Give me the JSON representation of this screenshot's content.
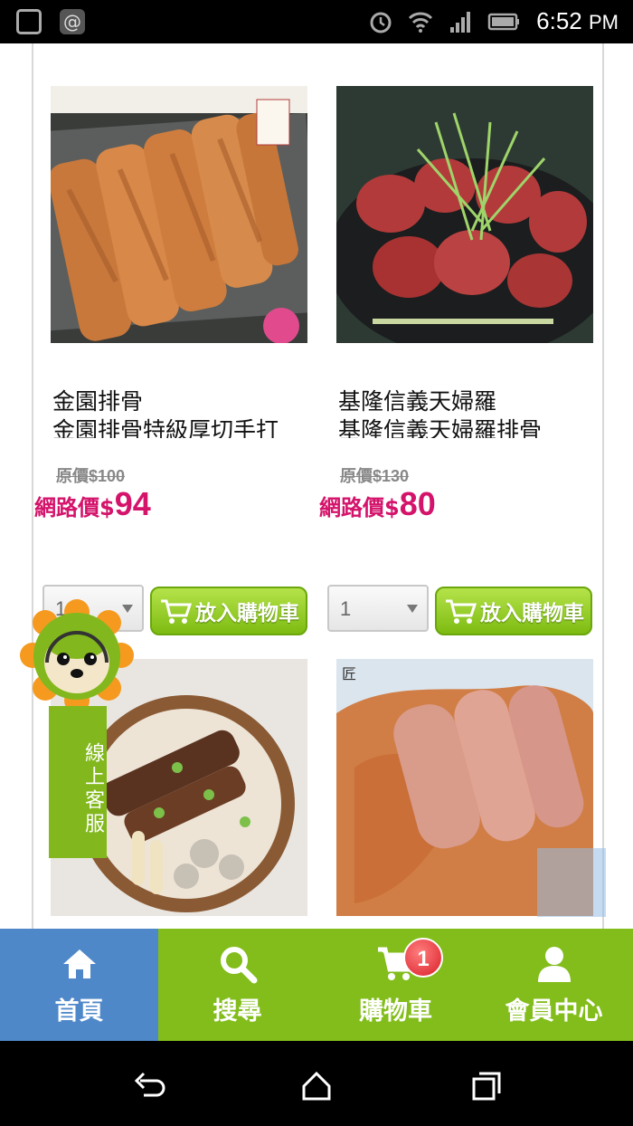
{
  "status_bar": {
    "time": "6:52",
    "ampm": "PM"
  },
  "products": [
    {
      "name_line1": "金園排骨",
      "name_line2": "金園排骨特級厚切手打",
      "orig_label": "原價",
      "orig_price": "$100",
      "web_label": "網路價$",
      "web_price": "94",
      "qty": "1",
      "add_to_cart": "放入購物車"
    },
    {
      "name_line1": "基隆信義天婦羅",
      "name_line2": "基隆信義天婦羅排骨",
      "orig_label": "原價",
      "orig_price": "$130",
      "web_label": "網路價$",
      "web_price": "80",
      "qty": "1",
      "add_to_cart": "放入購物車"
    }
  ],
  "cs_widget": {
    "label": "線上客服"
  },
  "bottom_nav": {
    "home": "首頁",
    "search": "搜尋",
    "cart": "購物車",
    "cart_badge": "1",
    "member": "會員中心"
  },
  "colors": {
    "price": "#d4136b",
    "nav_home": "#4f88c9",
    "nav_green": "#82bd1b",
    "button_green": "#7dbb11"
  }
}
